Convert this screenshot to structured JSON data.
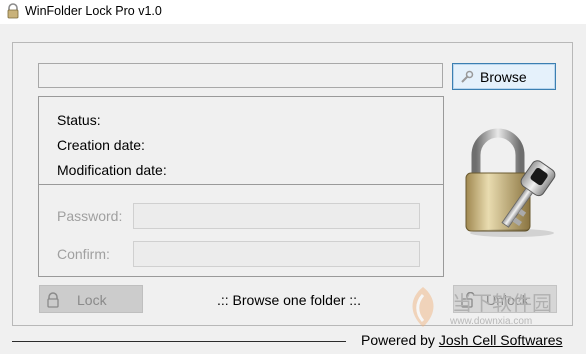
{
  "window": {
    "title": "WinFolder Lock Pro v1.0"
  },
  "path_field": {
    "value": ""
  },
  "browse": {
    "label": "Browse"
  },
  "info": {
    "status_label": "Status:",
    "creation_label": "Creation date:",
    "modification_label": "Modification date:"
  },
  "password": {
    "label": "Password:",
    "value": ""
  },
  "confirm": {
    "label": "Confirm:",
    "value": ""
  },
  "lock": {
    "label": "Lock"
  },
  "unlock": {
    "label": "Unlock"
  },
  "status_message": ".:: Browse one folder ::.",
  "footer": {
    "prefix": "Powered by",
    "link": "Josh Cell Softwares"
  },
  "watermark": {
    "text": "当下软件园",
    "url": "www.downxia.com"
  },
  "icons": {
    "app": "app-icon",
    "browse": "wrench-icon",
    "lock": "padlock-icon",
    "unlock": "open-padlock-icon",
    "hero": "padlock-key-icon"
  }
}
